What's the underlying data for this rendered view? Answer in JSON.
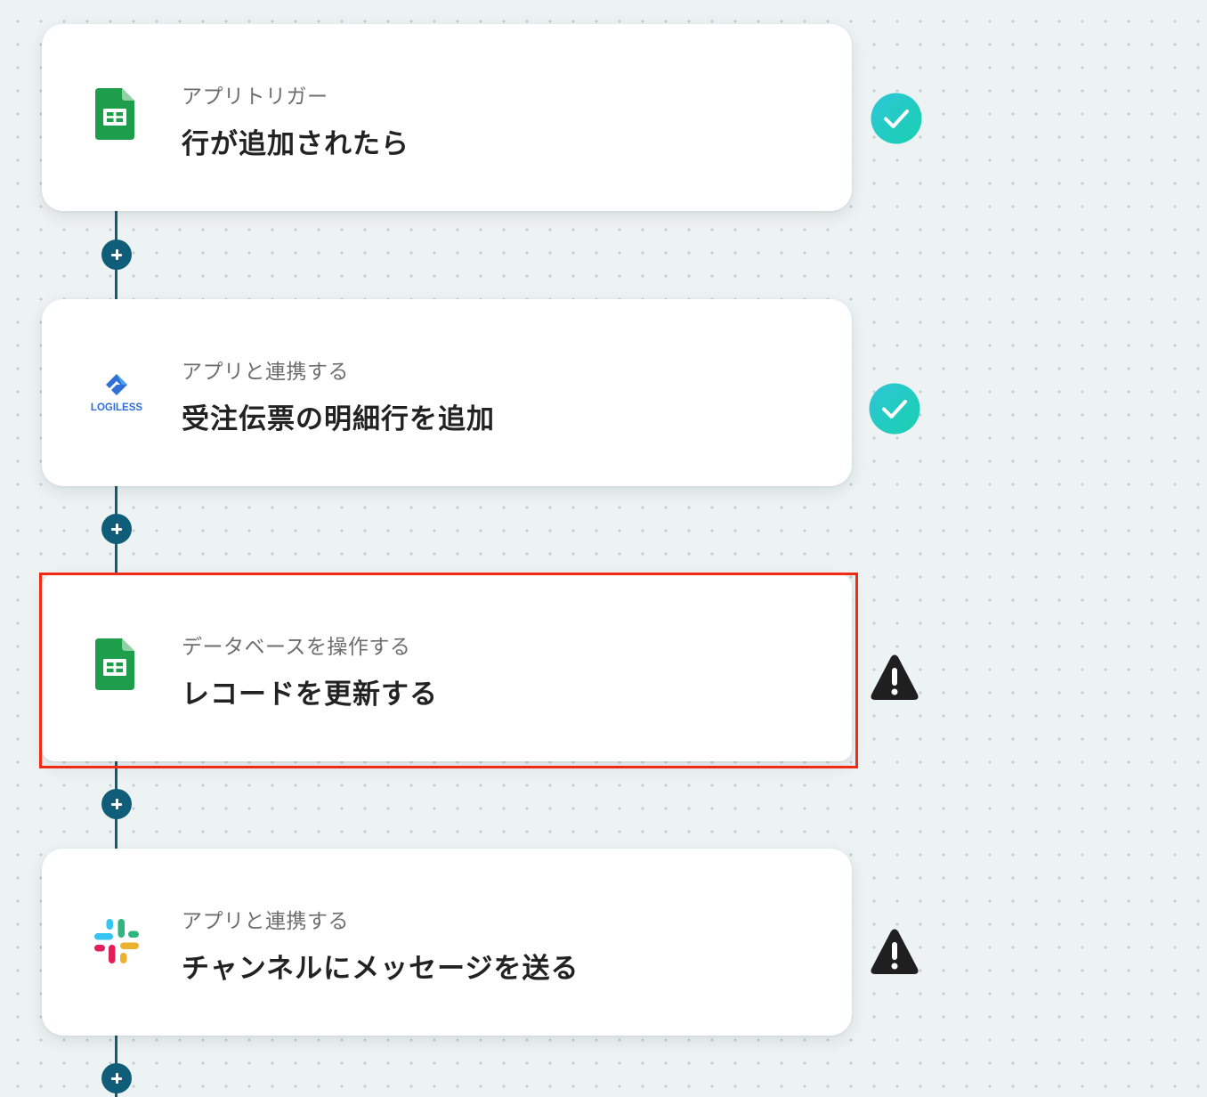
{
  "steps": [
    {
      "category": "アプリトリガー",
      "action": "行が追加されたら",
      "app_icon": "google-sheets-icon",
      "status": "success"
    },
    {
      "category": "アプリと連携する",
      "action": "受注伝票の明細行を追加",
      "app_icon": "logiless-icon",
      "app_logo_text": "LOGILESS",
      "status": "success"
    },
    {
      "category": "データベースを操作する",
      "action": "レコードを更新する",
      "app_icon": "google-sheets-icon",
      "status": "warning",
      "selected": true
    },
    {
      "category": "アプリと連携する",
      "action": "チャンネルにメッセージを送る",
      "app_icon": "slack-icon",
      "status": "warning"
    }
  ],
  "colors": {
    "connector": "#0f5d78",
    "success_gradient_start": "#2ec6d6",
    "success_gradient_end": "#18d0b0",
    "warning": "#1f1f1f",
    "highlight": "#f12b13",
    "sheets_green": "#1e9e4a"
  }
}
